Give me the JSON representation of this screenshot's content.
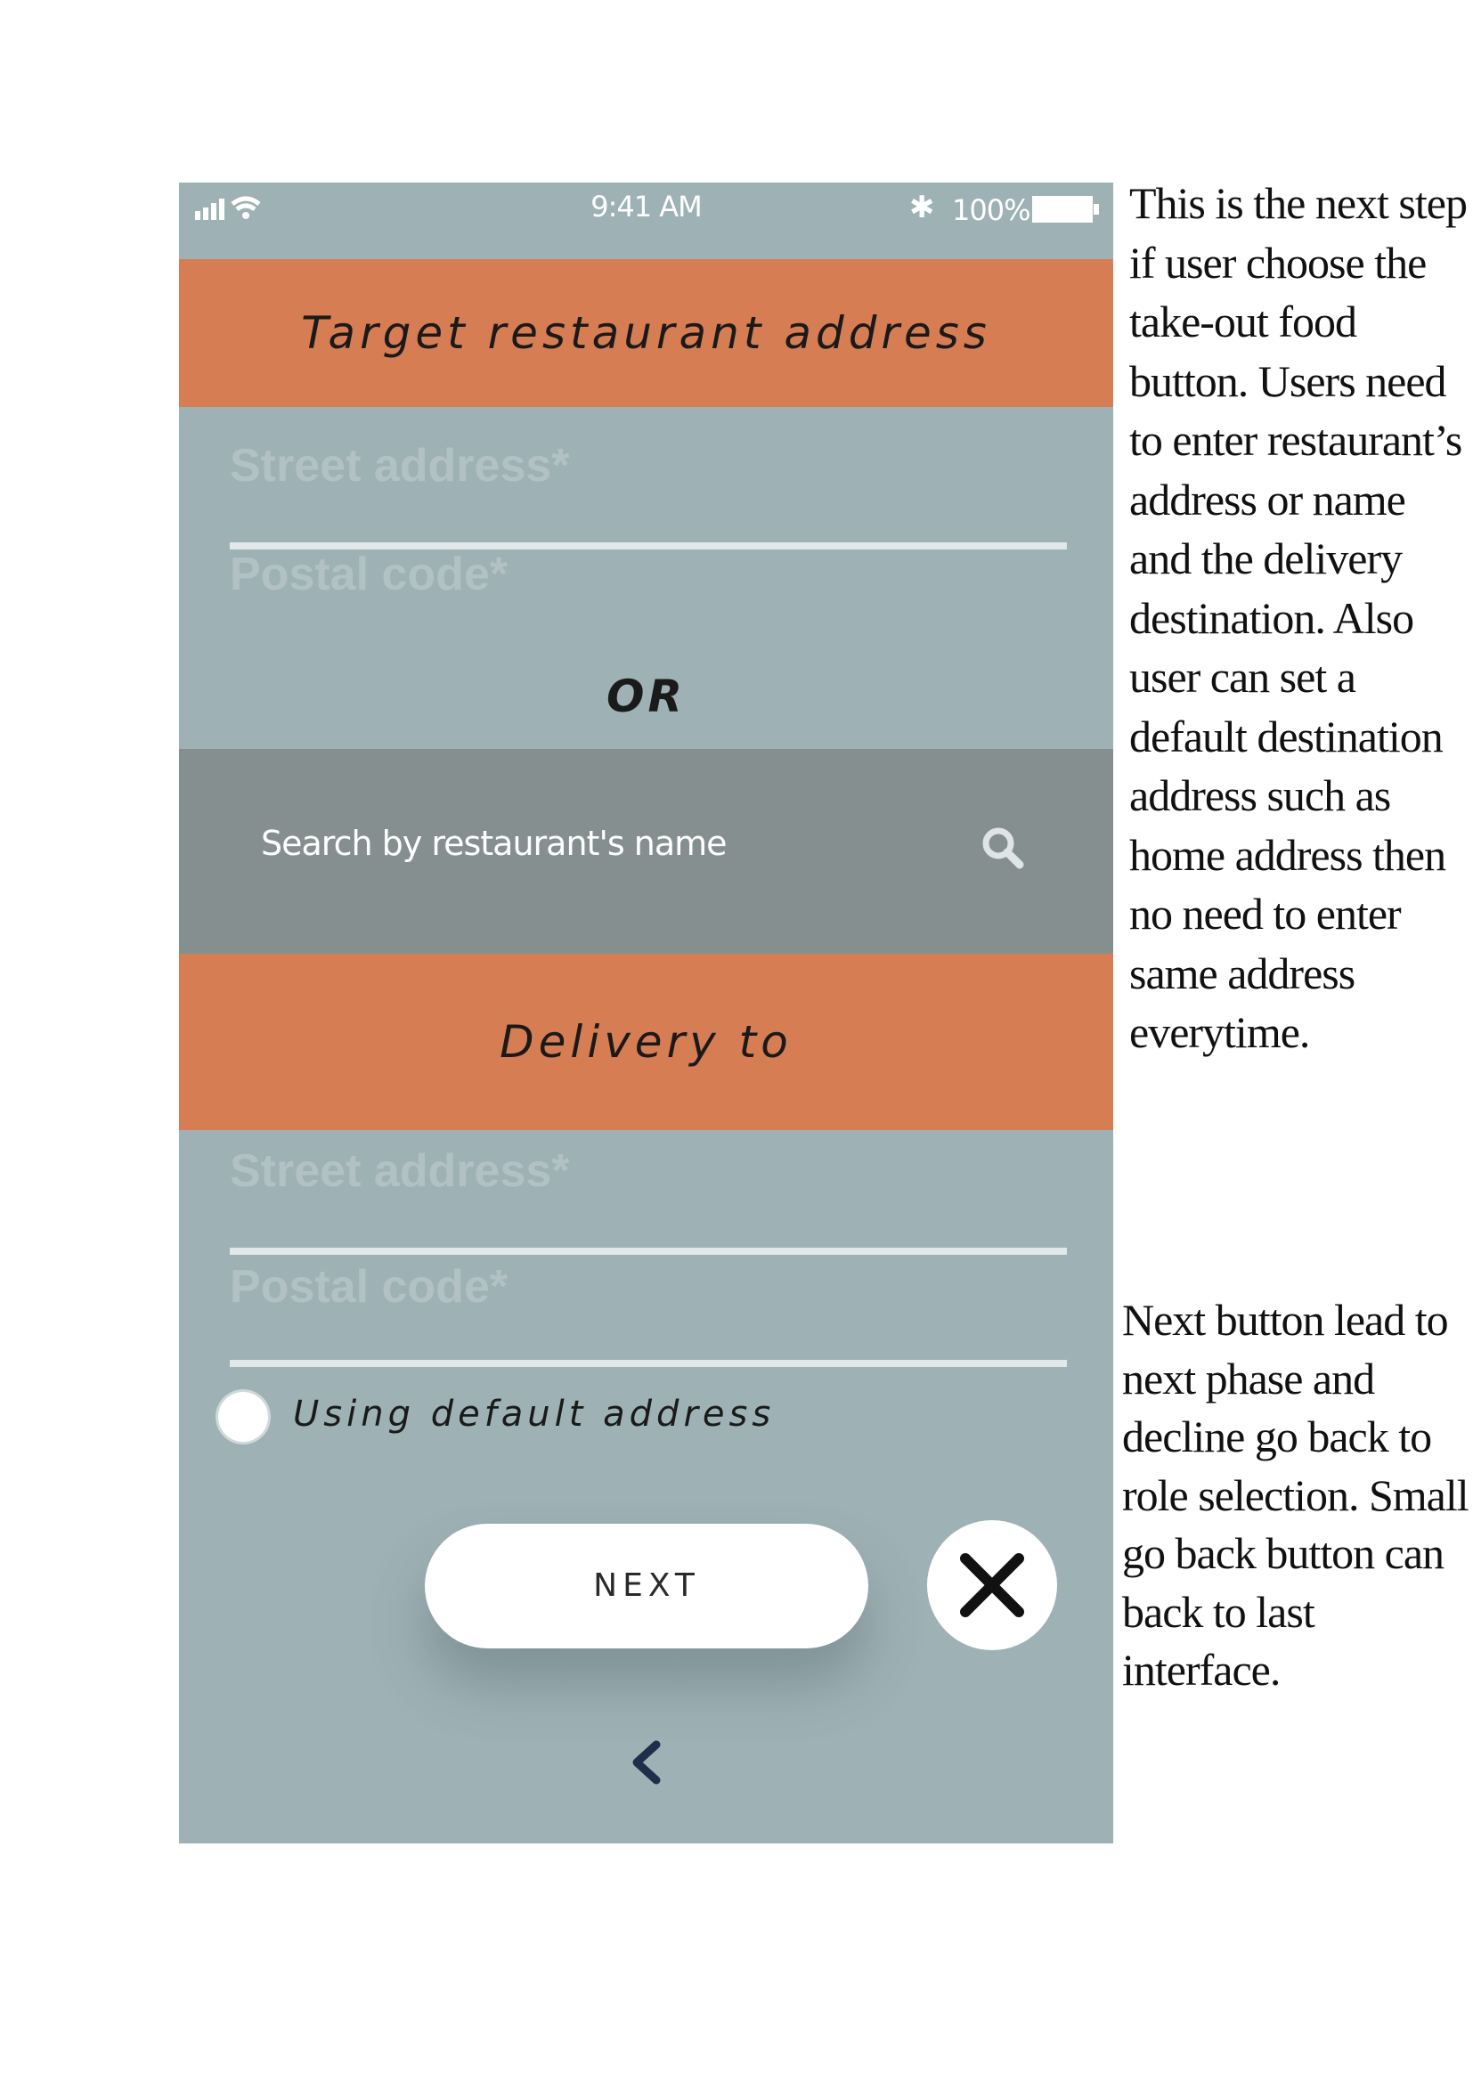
{
  "status_bar": {
    "time": "9:41 AM",
    "battery_label": "100%",
    "icons": [
      "signal-bars-icon",
      "wifi-icon",
      "bluetooth-icon",
      "battery-icon"
    ]
  },
  "restaurant_section": {
    "title": "Target restaurant address",
    "street_placeholder": "Street address*",
    "postal_placeholder": "Postal code*"
  },
  "or_label": "OR",
  "search": {
    "placeholder": "Search by restaurant's name",
    "icon": "search-icon"
  },
  "delivery_section": {
    "title": "Delivery to",
    "street_placeholder": "Street address*",
    "postal_placeholder": "Postal code*"
  },
  "default_address": {
    "label": "Using default address",
    "checked": false
  },
  "actions": {
    "next_label": "NEXT",
    "close_icon": "close-icon",
    "back_icon": "chevron-left-icon"
  },
  "description": {
    "paragraph1": "This is the next step if user choose the take-out food button. Users need to enter restaurant’s address or name and the delivery destination. Also user can set a default destination address such as home address then no need to enter same address everytime.",
    "paragraph2": "Next button lead to next phase and decline go back to role selection. Small go back button can back to last interface."
  },
  "colors": {
    "accent_orange": "#d77d54",
    "phone_background": "#9eb1b5",
    "search_background": "#868f90"
  }
}
